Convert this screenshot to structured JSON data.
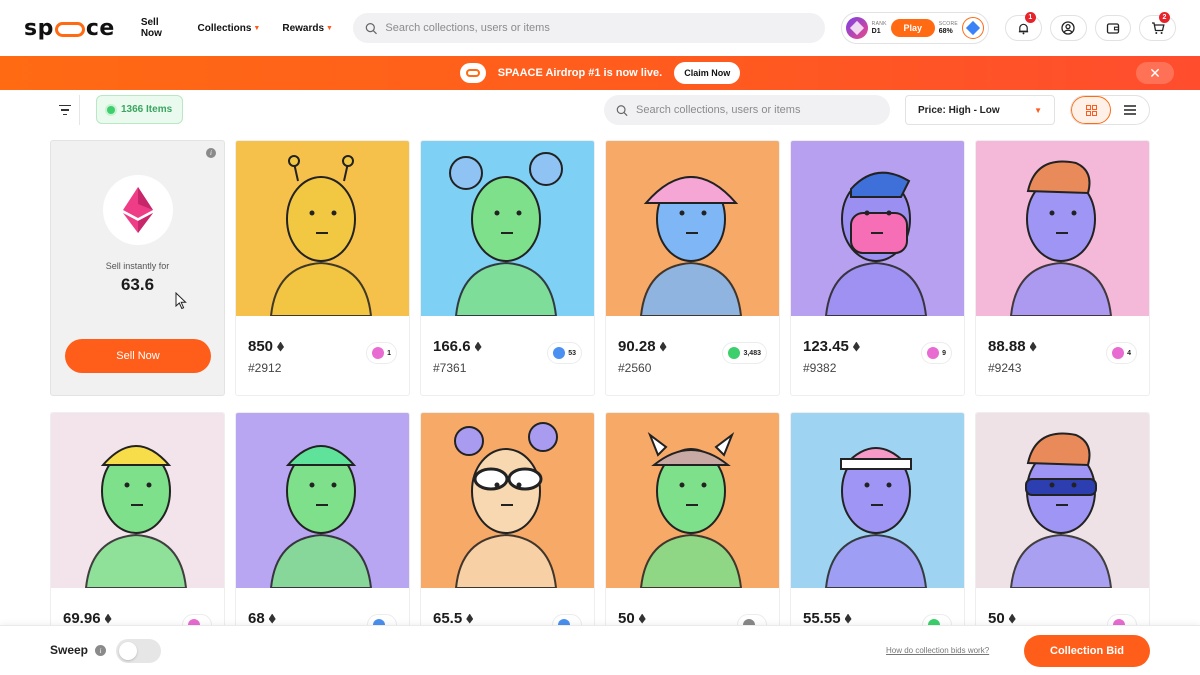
{
  "header": {
    "logo": {
      "before": "sp",
      "after": "ce"
    },
    "nav": [
      {
        "label": "Sell Now",
        "has_caret": false
      },
      {
        "label": "Collections",
        "has_caret": true
      },
      {
        "label": "Rewards",
        "has_caret": true
      }
    ],
    "search_placeholder": "Search collections, users or items",
    "rank": {
      "label": "RANK",
      "value": "D1"
    },
    "play_label": "Play",
    "score": {
      "label": "SCORE",
      "value": "68%"
    },
    "notifications_count": "1",
    "cart_count": "2"
  },
  "banner": {
    "text": "SPAACE Airdrop #1 is now live.",
    "cta": "Claim Now",
    "close": "✕"
  },
  "filters": {
    "items_count": "1366 Items",
    "search_placeholder": "Search collections, users or items",
    "sort": "Price: High - Low"
  },
  "sell_card": {
    "label": "Sell instantly for",
    "value": "63.6",
    "button": "Sell Now",
    "info": "i"
  },
  "nfts": [
    {
      "price": "850",
      "token": "#2912",
      "rank": "1",
      "rank_color": "#e86bd2",
      "bg": "#f6c14a",
      "skin": "#f2c742",
      "style": "alien"
    },
    {
      "price": "166.6",
      "token": "#7361",
      "rank": "53",
      "rank_color": "#4a90f0",
      "bg": "#7fd0f5",
      "skin": "#7ee08a",
      "style": "buns"
    },
    {
      "price": "90.28",
      "token": "#2560",
      "rank": "3,483",
      "rank_color": "#3ccf6c",
      "bg": "#f7a968",
      "skin": "#7fb6f5",
      "style": "bucket"
    },
    {
      "price": "123.45",
      "token": "#9382",
      "rank": "9",
      "rank_color": "#e86bd2",
      "bg": "#b8a0f0",
      "skin": "#9b8ff2",
      "style": "mask"
    },
    {
      "price": "88.88",
      "token": "#9243",
      "rank": "4",
      "rank_color": "#e86bd2",
      "bg": "#f4b8d8",
      "skin": "#9f95f5",
      "style": "curly"
    },
    {
      "price": "69.96",
      "token": "",
      "rank": "",
      "rank_color": "#e86bd2",
      "bg": "#f2e4ea",
      "skin": "#7ee08a",
      "style": "bowl"
    },
    {
      "price": "68",
      "token": "",
      "rank": "",
      "rank_color": "#4a90f0",
      "bg": "#b9a6f2",
      "skin": "#7ee08a",
      "style": "green"
    },
    {
      "price": "65.5",
      "token": "",
      "rank": "",
      "rank_color": "#4a90f0",
      "bg": "#f7a968",
      "skin": "#f7d8b0",
      "style": "goggles"
    },
    {
      "price": "50",
      "token": "",
      "rank": "",
      "rank_color": "#888888",
      "bg": "#f7a968",
      "skin": "#7ee08a",
      "style": "viking"
    },
    {
      "price": "55.55",
      "token": "",
      "rank": "",
      "rank_color": "#3ccf6c",
      "bg": "#9ed4f2",
      "skin": "#9f95f5",
      "style": "headband"
    },
    {
      "price": "50",
      "token": "",
      "rank": "",
      "rank_color": "#e86bd2",
      "bg": "#efe2e6",
      "skin": "#9f95f5",
      "style": "shades"
    }
  ],
  "bottom": {
    "sweep": "Sweep",
    "sweep_info": "i",
    "how_link": "How do collection bids work?",
    "bid_button": "Collection Bid"
  },
  "colors": {
    "accent": "#ff5e1a",
    "green": "#3ccf6c"
  },
  "icons": [
    "search-icon",
    "bell-icon",
    "user-icon",
    "wallet-icon",
    "cart-icon",
    "filter-icon",
    "grid-icon",
    "list-icon",
    "ethereum-icon",
    "close-icon"
  ]
}
